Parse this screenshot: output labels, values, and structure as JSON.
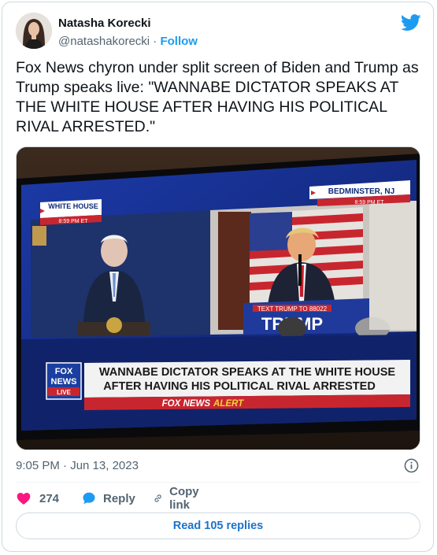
{
  "author": {
    "name": "Natasha Korecki",
    "handle": "@natashakorecki",
    "separator": "·",
    "follow_label": "Follow",
    "avatar_icon": "user-avatar",
    "brand_icon": "twitter-bird-icon",
    "brand_color": "#1d9bf0"
  },
  "tweet": {
    "text": "Fox News chyron under split screen of Biden and Trump as Trump speaks live: \"WANNABE DICTATOR SPEAKS AT THE WHITE HOUSE AFTER HAVING HIS POLITICAL RIVAL ARRESTED.\""
  },
  "media": {
    "left_location": "WHITE HOUSE",
    "left_time": "8:59 PM ET",
    "right_location": "BEDMINSTER, NJ",
    "right_time": "8:59 PM ET",
    "podium_sign_top": "TEXT TRUMP TO 88022",
    "podium_sign_main": "TRUMP",
    "chyron_line1": "WANNABE DICTATOR SPEAKS AT THE WHITE HOUSE",
    "chyron_line2": "AFTER HAVING HIS POLITICAL RIVAL ARRESTED",
    "alert_prefix": "FOX NEWS",
    "alert_word": "ALERT",
    "logo_line1": "FOX",
    "logo_line2": "NEWS",
    "logo_line3": "LIVE"
  },
  "meta": {
    "timestamp": "9:05 PM · Jun 13, 2023",
    "info_icon": "info-icon"
  },
  "actions": {
    "likes": "274",
    "reply_label": "Reply",
    "copy_label": "Copy link",
    "like_color": "#f91880",
    "accent_color": "#1d9bf0"
  },
  "footer": {
    "read_replies_label": "Read 105 replies"
  }
}
